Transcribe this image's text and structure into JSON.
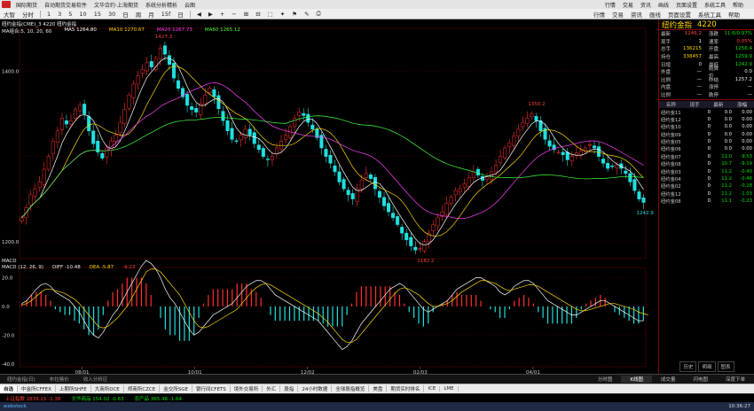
{
  "menubar": {
    "items": [
      "国际期货",
      "自动期货交易软件",
      "文华合约·上海期货",
      "系统分析精析",
      "云图"
    ],
    "right_items": [
      "行情",
      "交易",
      "资讯",
      "画线",
      "页面设置",
      "系统工具",
      "帮助"
    ]
  },
  "toolbar": {
    "items": [
      "大智",
      "分时",
      "1",
      "3",
      "5",
      "10",
      "15",
      "30",
      "日",
      "周",
      "月",
      "15f",
      "日",
      "◀",
      "▶",
      "+",
      "−",
      "⊞",
      "⊟",
      "⬚",
      "✦",
      "⚑",
      "✎",
      "⎙"
    ],
    "right_items": [
      "行情",
      "交易",
      "资讯",
      "画线",
      "页面设置",
      "系统工具",
      "帮助"
    ]
  },
  "chart_header": {
    "line1": "纽约金指(CME)_3   4220 纽约金指",
    "line2_label": "MA组合:5, 10, 20, 60",
    "ma5": "MA5 1264.80",
    "ma10": "MA10 1270.67",
    "ma20": "MA20 1267.73",
    "ma60": "MA60 1265.12"
  },
  "price_axis": {
    "high_label": "1400.0",
    "low_label": "1200.0",
    "peak_label": "1427.3",
    "trough_label": "1182.2",
    "mid_peak_label": "1350.2",
    "last_label": "1242.9"
  },
  "macd": {
    "header": "MACD (12, 26, 9)",
    "diff": "DIFF  -10.48",
    "dea": "DEA  -5.87",
    "macd_val": "-9.23",
    "label": "MACD",
    "axis_labels": [
      "20.0",
      "0.0",
      "-20.0",
      "-40.0"
    ]
  },
  "time_axis": [
    "08/01",
    "10/01",
    "12/02",
    "02/03",
    "04/01"
  ],
  "right_panel": {
    "title_name": "纽约金指",
    "title_code": "4220",
    "quote_rows": [
      {
        "k": "最新",
        "v": "1246.2",
        "vc": "red",
        "k2": "涨跌",
        "v2": "11.6/0.97%",
        "v2c": "green"
      },
      {
        "k": "现手",
        "v": "1",
        "vc": "white",
        "k2": "速率",
        "v2": "0.05%",
        "v2c": "red"
      },
      {
        "k": "总手",
        "v": "136215",
        "vc": "yellow",
        "k2": "开盘",
        "v2": "1256.4",
        "v2c": "green"
      },
      {
        "k": "持仓",
        "v": "338457",
        "vc": "yellow",
        "k2": "最高",
        "v2": "1259.9",
        "v2c": "green"
      },
      {
        "k": "日增",
        "v": "0",
        "vc": "white",
        "k2": "最低",
        "v2": "1242.9",
        "v2c": "green"
      },
      {
        "k": "外盘",
        "v": "—",
        "vc": "white",
        "k2": "结算价",
        "v2": "0.0",
        "v2c": "white"
      },
      {
        "k": "比例",
        "v": "—",
        "vc": "white",
        "k2": "昨结",
        "v2": "1257.2",
        "v2c": "white"
      },
      {
        "k": "内盘",
        "v": "—",
        "vc": "white",
        "k2": "涨停",
        "v2": "—",
        "v2c": "white"
      },
      {
        "k": "比例",
        "v": "—",
        "vc": "white",
        "k2": "跌停",
        "v2": "—",
        "v2c": "white"
      }
    ],
    "list_header": [
      "名称",
      "现手",
      "最新",
      "涨幅"
    ],
    "sub_header": [
      "品名",
      "成交量",
      "最新",
      "涨幅"
    ],
    "list_rows": [
      {
        "name": "纽约金11",
        "a": "0",
        "b": "0.0",
        "c": "0.00",
        "bc": "white",
        "cc": "white"
      },
      {
        "name": "纽约金12",
        "a": "0",
        "b": "0.0",
        "c": "0.00",
        "bc": "white",
        "cc": "white"
      },
      {
        "name": "纽约金10",
        "a": "0",
        "b": "0.0",
        "c": "0.00",
        "bc": "white",
        "cc": "white"
      },
      {
        "name": "纽约金09",
        "a": "0",
        "b": "0.0",
        "c": "0.00",
        "bc": "white",
        "cc": "white"
      },
      {
        "name": "纽约金05",
        "a": "0",
        "b": "0.0",
        "c": "0.00",
        "bc": "white",
        "cc": "white"
      },
      {
        "name": "纽约金06",
        "a": "0",
        "b": "0.0",
        "c": "0.00",
        "bc": "white",
        "cc": "white"
      },
      {
        "name": "纽约金07",
        "a": "0",
        "b": "11.0",
        "c": "-9.53",
        "bc": "green",
        "cc": "green"
      },
      {
        "name": "纽约金08",
        "a": "0",
        "b": "10.7",
        "c": "-9.19",
        "bc": "green",
        "cc": "green"
      },
      {
        "name": "纽约金03",
        "a": "0",
        "b": "11.2",
        "c": "-0.40",
        "bc": "green",
        "cc": "green"
      },
      {
        "name": "纽约金04",
        "a": "0",
        "b": "11.2",
        "c": "-0.46",
        "bc": "green",
        "cc": "green"
      },
      {
        "name": "纽约金02",
        "a": "0",
        "b": "11.2",
        "c": "-0.28",
        "bc": "green",
        "cc": "green"
      },
      {
        "name": "纽约金12",
        "a": "0",
        "b": "11.2",
        "c": "-1.03",
        "bc": "green",
        "cc": "green"
      },
      {
        "name": "纽约金08",
        "a": "0",
        "b": "11.1",
        "c": "-0.23",
        "bc": "green",
        "cc": "green"
      }
    ],
    "buttons": [
      "历史",
      "明细",
      "图表"
    ]
  },
  "tabbar": {
    "left": [
      "纽约金指(日)",
      "布拉格价",
      "收入分析区"
    ],
    "center": [
      "分时图",
      "K线图",
      "成交量",
      "闪电图",
      "深度下单"
    ],
    "active_center": 1
  },
  "market_tabs": [
    "自选",
    "中金所CFFEX",
    "上期所SHFE",
    "大商所DCE",
    "郑商所CZCE",
    "金交所SGE",
    "银行间CFETS",
    "境外交易所",
    "外汇",
    "股指",
    "24小时数据",
    "全球股指概览",
    "美盘",
    "期货实时排名",
    "ICE",
    "LME"
  ],
  "active_market_tab": 0,
  "statusbar": {
    "items": [
      {
        "t": "上证指数  2839.21  -1.38",
        "c": "red"
      },
      {
        "t": "文华商品  154.02  -0.63",
        "c": "green"
      },
      {
        "t": "农产品  365.48  -1.64",
        "c": "green"
      }
    ]
  },
  "taskbar": {
    "left": "webstock",
    "time": "10:36:27"
  },
  "chart_data": {
    "type": "candlestick",
    "series_ma": [
      "MA5",
      "MA10",
      "MA20",
      "MA60"
    ],
    "ylim": [
      1180,
      1440
    ],
    "x_labels": [
      "08/01",
      "10/01",
      "12/02",
      "02/03",
      "04/01"
    ],
    "close": [
      1228,
      1240,
      1255,
      1262,
      1270,
      1285,
      1300,
      1318,
      1330,
      1345,
      1338,
      1342,
      1355,
      1360,
      1350,
      1330,
      1315,
      1305,
      1298,
      1310,
      1318,
      1325,
      1340,
      1355,
      1372,
      1385,
      1395,
      1402,
      1410,
      1405,
      1415,
      1427,
      1420,
      1408,
      1392,
      1380,
      1370,
      1360,
      1355,
      1352,
      1362,
      1372,
      1380,
      1370,
      1356,
      1342,
      1330,
      1320,
      1318,
      1325,
      1332,
      1325,
      1315,
      1308,
      1300,
      1296,
      1300,
      1310,
      1318,
      1325,
      1335,
      1345,
      1352,
      1348,
      1340,
      1332,
      1322,
      1310,
      1300,
      1292,
      1282,
      1270,
      1262,
      1255,
      1250,
      1262,
      1272,
      1280,
      1274,
      1262,
      1252,
      1242,
      1235,
      1228,
      1220,
      1210,
      1202,
      1195,
      1190,
      1192,
      1200,
      1210,
      1220,
      1228,
      1235,
      1245,
      1252,
      1260,
      1262,
      1268,
      1275,
      1282,
      1278,
      1272,
      1276,
      1282,
      1290,
      1300,
      1310,
      1316,
      1324,
      1332,
      1340,
      1345,
      1350,
      1342,
      1330,
      1320,
      1312,
      1308,
      1305,
      1302,
      1296,
      1300,
      1304,
      1306,
      1310,
      1314,
      1310,
      1300,
      1292,
      1286,
      1288,
      1290,
      1286,
      1280,
      1270,
      1260,
      1250,
      1246
    ],
    "macd_diff": [
      2,
      4,
      8,
      12,
      15,
      16,
      14,
      10,
      8,
      6,
      4,
      0,
      -4,
      -10,
      -16,
      -20,
      -22,
      -18,
      -12,
      -6,
      -2,
      4,
      10,
      16,
      22,
      28,
      32,
      30,
      26,
      20,
      12,
      6,
      2,
      -4,
      -10,
      -16,
      -20,
      -18,
      -14,
      -10,
      -6,
      -4,
      -2,
      0,
      2,
      6,
      10,
      14,
      16,
      18,
      18,
      16,
      12,
      8,
      6,
      4,
      2,
      0,
      -2,
      -4,
      -6,
      -8,
      -10,
      -14,
      -18,
      -22,
      -26,
      -30,
      -28,
      -24,
      -18,
      -12,
      -8,
      -4,
      0,
      4,
      8,
      12,
      14,
      16,
      14,
      10,
      6,
      2,
      -2,
      -4,
      -2,
      0,
      2,
      4,
      8,
      12,
      14,
      16,
      18,
      20,
      20,
      18,
      16,
      14,
      10,
      8,
      10,
      14,
      16,
      18,
      18,
      16,
      12,
      8,
      4,
      2,
      0,
      -2,
      -4,
      -6,
      -6,
      -4,
      -2,
      0,
      2,
      4,
      4,
      2,
      0,
      -2,
      -4,
      -6,
      -8,
      -10,
      -10
    ],
    "macd_dea": [
      1,
      2,
      4,
      7,
      10,
      12,
      12,
      11,
      10,
      9,
      7,
      5,
      2,
      -2,
      -6,
      -10,
      -14,
      -15,
      -14,
      -11,
      -8,
      -4,
      0,
      6,
      12,
      18,
      24,
      26,
      26,
      24,
      20,
      16,
      12,
      8,
      2,
      -4,
      -10,
      -14,
      -15,
      -14,
      -12,
      -10,
      -8,
      -6,
      -4,
      -2,
      2,
      6,
      10,
      13,
      15,
      16,
      15,
      13,
      11,
      9,
      7,
      5,
      3,
      1,
      -1,
      -3,
      -5,
      -8,
      -11,
      -15,
      -19,
      -23,
      -25,
      -25,
      -23,
      -19,
      -15,
      -11,
      -7,
      -3,
      1,
      5,
      9,
      12,
      13,
      12,
      10,
      8,
      5,
      2,
      0,
      0,
      1,
      2,
      4,
      7,
      10,
      12,
      14,
      16,
      18,
      18,
      17,
      16,
      14,
      12,
      11,
      12,
      13,
      14,
      15,
      15,
      14,
      12,
      10,
      8,
      6,
      4,
      2,
      0,
      -2,
      -3,
      -3,
      -2,
      -1,
      0,
      1,
      2,
      2,
      1,
      0,
      -1,
      -2,
      -4,
      -5,
      -6
    ]
  }
}
